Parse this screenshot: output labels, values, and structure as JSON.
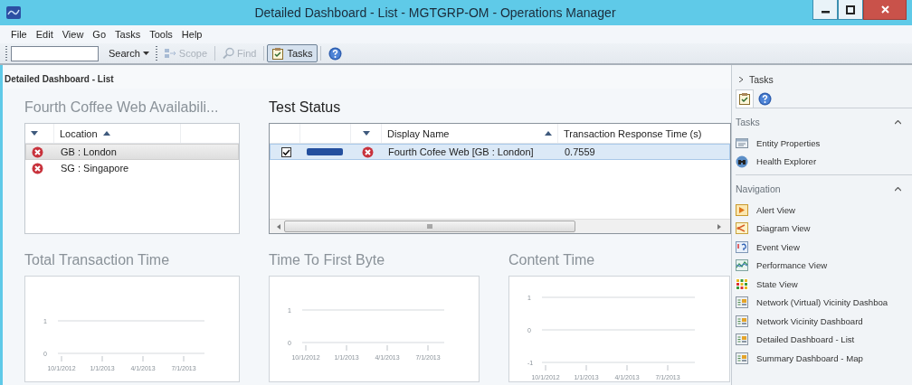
{
  "window": {
    "title": "Detailed Dashboard - List - MGTGRP-OM - Operations Manager"
  },
  "menu": [
    "File",
    "Edit",
    "View",
    "Go",
    "Tasks",
    "Tools",
    "Help"
  ],
  "toolbar": [
    {
      "kind": "search_field"
    },
    {
      "kind": "dropdown",
      "label": "Search",
      "disabled": false,
      "pressed": false
    },
    {
      "kind": "scope",
      "label": "Scope",
      "disabled": true,
      "pressed": false
    },
    {
      "kind": "find",
      "label": "Find",
      "disabled": true,
      "pressed": false
    },
    {
      "kind": "tasks",
      "label": "Tasks",
      "disabled": false,
      "pressed": true
    },
    {
      "kind": "help",
      "disabled": false,
      "pressed": false
    }
  ],
  "page_title": "Detailed Dashboard - List",
  "availability": {
    "title": "Fourth Coffee Web Availabili...",
    "column": "Location",
    "rows": [
      {
        "location": "GB : London",
        "kind": "critical",
        "selected": true
      },
      {
        "location": "SG : Singapore",
        "kind": "critical",
        "selected": false
      }
    ]
  },
  "test_status": {
    "title": "Test Status",
    "columns": [
      "Display Name",
      "Transaction Response Time (s)"
    ],
    "rows": [
      {
        "checked": true,
        "color": "#234f9e",
        "kind": "critical",
        "display_name": "Fourth Cofee Web [GB : London]",
        "response_time": "0.7559",
        "selected": true
      }
    ]
  },
  "charts": [
    {
      "title": "Total Transaction Time",
      "y_labels": [
        "1",
        "0"
      ],
      "x_labels": [
        "10/1/2012",
        "1/1/2013",
        "4/1/2013",
        "7/1/2013"
      ]
    },
    {
      "title": "Time To First Byte",
      "y_labels": [
        "1",
        "0"
      ],
      "x_labels": [
        "10/1/2012",
        "1/1/2013",
        "4/1/2013",
        "7/1/2013"
      ]
    },
    {
      "title": "Content Time",
      "y_labels": [
        "1",
        "0",
        "-1"
      ],
      "x_labels": [
        "10/1/2012",
        "1/1/2013",
        "4/1/2013",
        "7/1/2013"
      ]
    }
  ],
  "task_pane": {
    "header": "Tasks",
    "tabs": [
      {
        "kind": "tasks",
        "selected": true
      },
      {
        "kind": "help",
        "selected": false
      }
    ],
    "sections": [
      {
        "title": "Tasks",
        "expanded": true,
        "items": [
          {
            "label": "Entity Properties",
            "kind": "properties"
          },
          {
            "label": "Health Explorer",
            "kind": "binoculars"
          }
        ]
      },
      {
        "title": "Navigation",
        "expanded": true,
        "items": [
          {
            "label": "Alert View",
            "kind": "alert"
          },
          {
            "label": "Diagram View",
            "kind": "diagram"
          },
          {
            "label": "Event View",
            "kind": "event"
          },
          {
            "label": "Performance View",
            "kind": "performance"
          },
          {
            "label": "State View",
            "kind": "state"
          },
          {
            "label": "Network (Virtual) Vicinity Dashboa",
            "kind": "dashboard"
          },
          {
            "label": "Network Vicinity Dashboard",
            "kind": "dashboard"
          },
          {
            "label": "Detailed Dashboard - List",
            "kind": "dashboard"
          },
          {
            "label": "Summary Dashboard - Map",
            "kind": "dashboard"
          }
        ]
      }
    ]
  }
}
